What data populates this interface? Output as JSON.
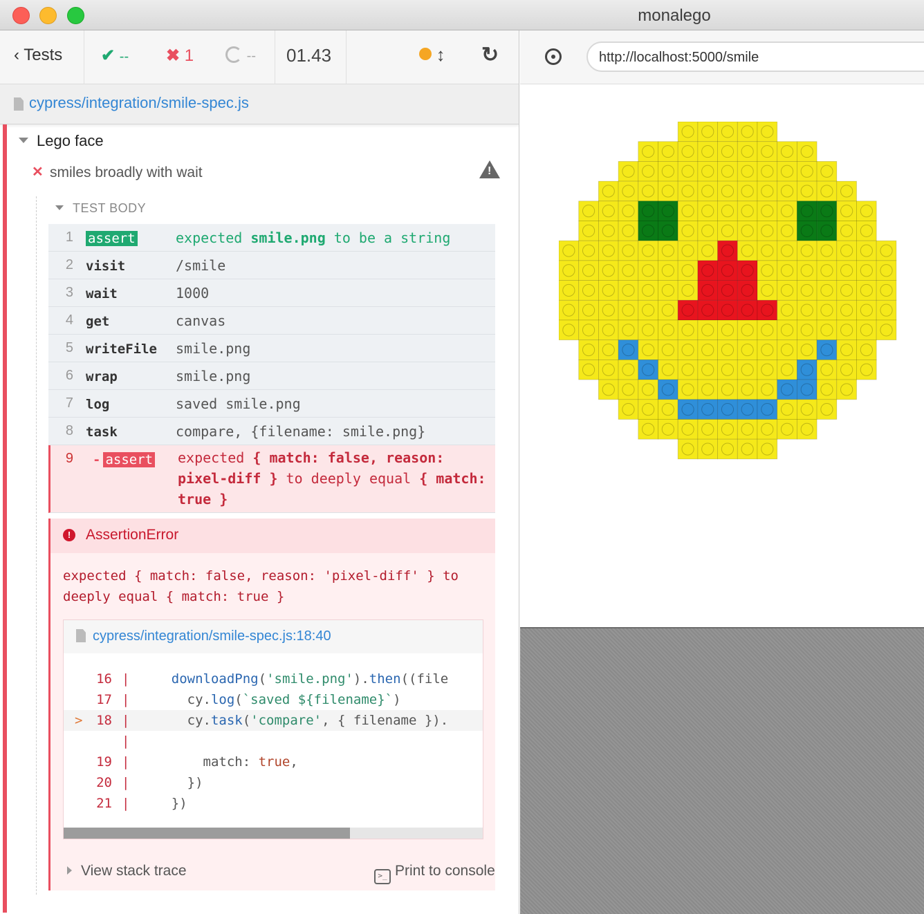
{
  "window": {
    "title": "monalego"
  },
  "toolbar": {
    "tests_label": "Tests",
    "passed": "--",
    "failed": "1",
    "pending": "--",
    "duration": "01.43"
  },
  "spec": {
    "path": "cypress/integration/smile-spec.js"
  },
  "suite": {
    "title": "Lego face"
  },
  "test": {
    "title": "smiles broadly with wait",
    "section": "TEST BODY"
  },
  "commands": [
    {
      "num": "1",
      "name": "assert",
      "msg_pre": "expected ",
      "msg_b": "smile.png",
      "msg_post": " to be a string"
    },
    {
      "num": "2",
      "name": "visit",
      "msg": "/smile"
    },
    {
      "num": "3",
      "name": "wait",
      "msg": "1000"
    },
    {
      "num": "4",
      "name": "get",
      "msg": "canvas"
    },
    {
      "num": "5",
      "name": "writeFile",
      "msg": "smile.png"
    },
    {
      "num": "6",
      "name": "wrap",
      "msg": "smile.png"
    },
    {
      "num": "7",
      "name": "log",
      "msg": "saved smile.png"
    },
    {
      "num": "8",
      "name": "task",
      "msg": "compare, {filename: smile.png}"
    },
    {
      "num": "9",
      "name": "assert",
      "prefix": "-"
    }
  ],
  "failed_command": {
    "p1": "expected ",
    "b1": "{ match: false, reason: pixel-diff }",
    "p2": " to deeply equal ",
    "b2": "{ match: true }"
  },
  "error": {
    "name": "AssertionError",
    "message": "expected { match: false, reason: 'pixel-diff' } to deeply equal { match: true }",
    "location": "cypress/integration/smile-spec.js:18:40",
    "view_stack": "View stack trace",
    "print_console": "Print to console",
    "code_lines": [
      {
        "ln": "16",
        "mark": "",
        "src": "    downloadPng('smile.png').then((file"
      },
      {
        "ln": "17",
        "mark": "",
        "src": "      cy.log(`saved ${filename}`)"
      },
      {
        "ln": "18",
        "mark": ">",
        "src": "      cy.task('compare', { filename })."
      },
      {
        "ln": "",
        "mark": "",
        "src": ""
      },
      {
        "ln": "19",
        "mark": "",
        "src": "        match: true,"
      },
      {
        "ln": "20",
        "mark": "",
        "src": "      })"
      },
      {
        "ln": "21",
        "mark": "",
        "src": "    })"
      }
    ]
  },
  "aut": {
    "url": "http://localhost:5000/smile"
  },
  "lego": {
    "colors": {
      "Y": "#f5e91a",
      "G": "#0a7a16",
      "R": "#e8141e",
      "B": "#2f8fd9"
    },
    "rows": [
      "......YYYYY......",
      "....YYYYYYYYY....",
      "...YYYYYYYYYYY...",
      "..YYYYYYYYYYYYY..",
      ".YYYGGYYYYYYGGYY.",
      ".YYYGGYYYYYYGGYY.",
      "YYYYYYYYRYYYYYYYY",
      "YYYYYYYRRRYYYYYYY",
      "YYYYYYYRRRYYYYYYY",
      "YYYYYYRRRRRYYYYYY",
      "YYYYYYYYYYYYYYYYY",
      ".YYBYYYYYYYYYBYY.",
      ".YYYBYYYYYYYBYYY.",
      "..YYYBYYYYYBBYY..",
      "...YYYBBBBBYYY...",
      "....YYYYYYYYY....",
      "......YYYYY......"
    ]
  }
}
